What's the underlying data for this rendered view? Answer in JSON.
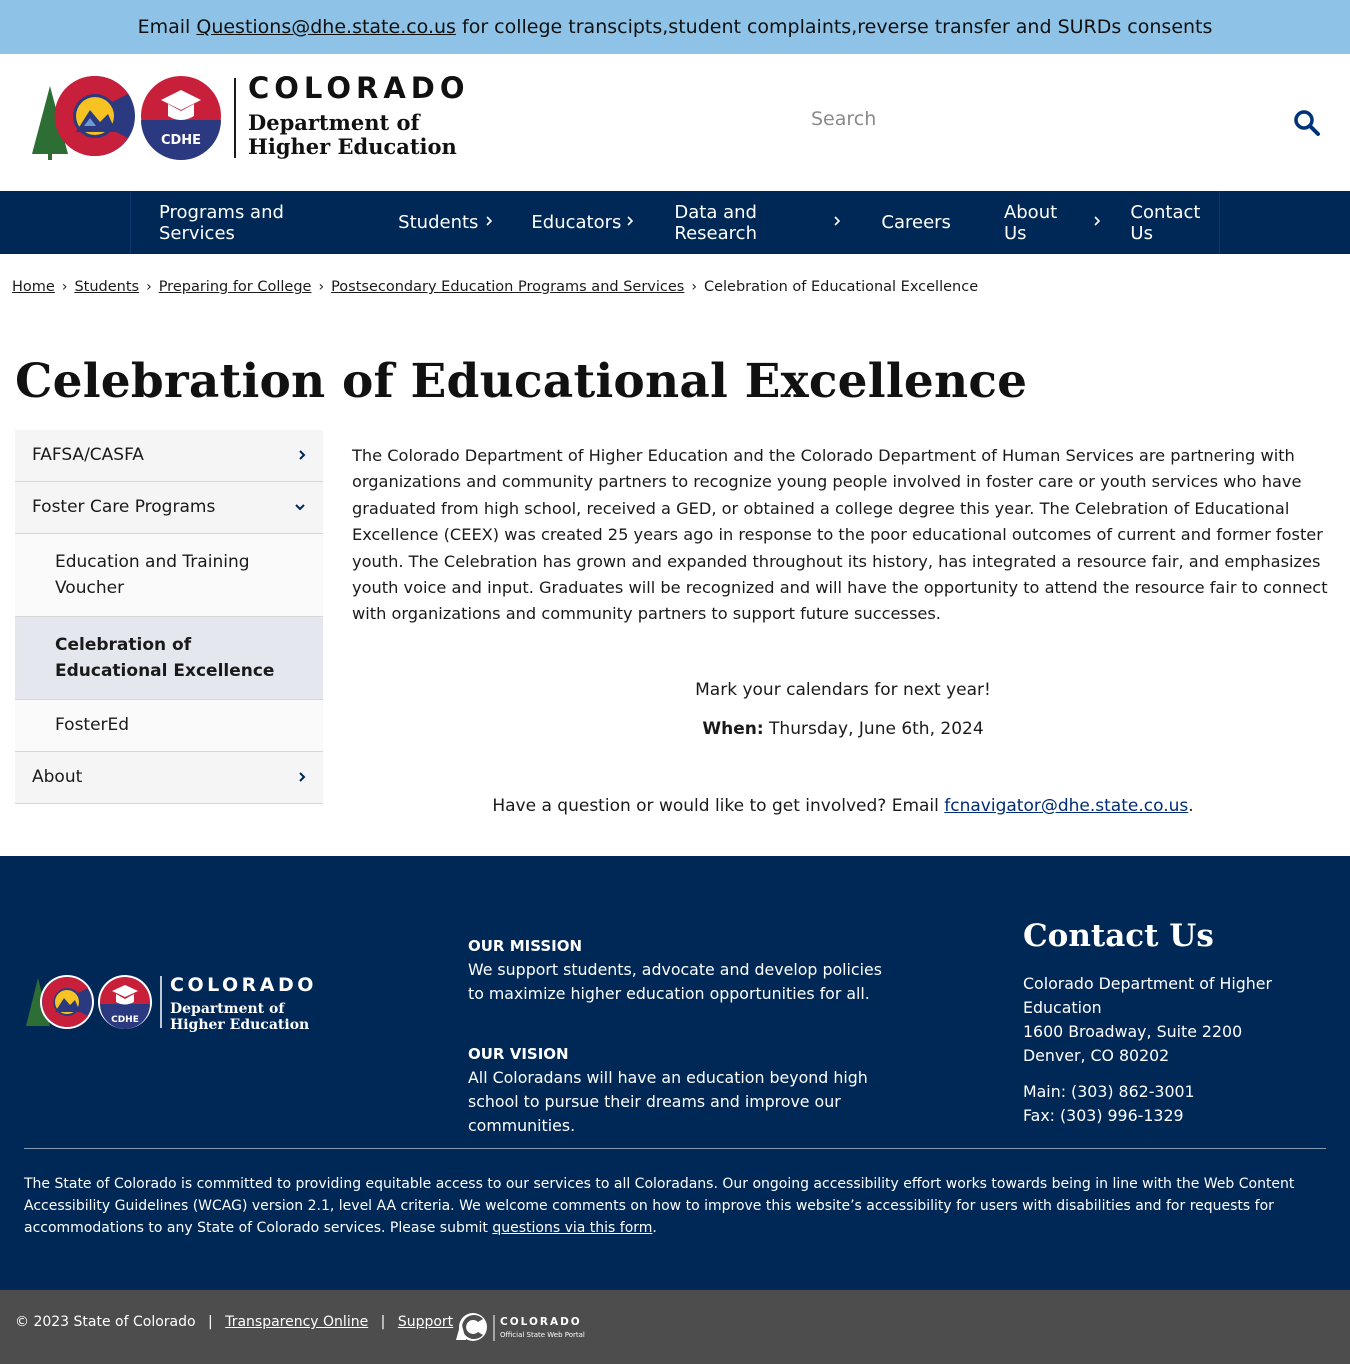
{
  "alert": {
    "prefix": "Email",
    "email": "Questions@dhe.state.co.us",
    "suffix": "for college transcipts,student complaints,reverse transfer and SURDs consents"
  },
  "header": {
    "logo_state": "COLORADO",
    "logo_dept_1": "Department of",
    "logo_dept_2": "Higher Education",
    "logo_badge": "CDHE",
    "search_placeholder": "Search"
  },
  "nav": {
    "items": [
      {
        "label": "Programs and Services",
        "has_submenu": false
      },
      {
        "label": "Students",
        "has_submenu": true
      },
      {
        "label": "Educators",
        "has_submenu": true
      },
      {
        "label": "Data and Research",
        "has_submenu": true
      },
      {
        "label": "Careers",
        "has_submenu": false
      },
      {
        "label": "About Us",
        "has_submenu": true
      },
      {
        "label": "Contact Us",
        "has_submenu": false
      }
    ]
  },
  "breadcrumb": {
    "items": [
      "Home",
      "Students",
      "Preparing for College",
      "Postsecondary Education Programs and Services"
    ],
    "current": "Celebration of Educational Excellence"
  },
  "page": {
    "title": "Celebration of Educational Excellence"
  },
  "sidebar": {
    "fafsa": "FAFSA/CASFA",
    "foster": "Foster Care Programs",
    "etv": "Education and Training Voucher",
    "ceex": "Celebration of Educational Excellence",
    "fostered": "FosterEd",
    "about": "About"
  },
  "content": {
    "intro": "The Colorado Department of Higher Education and the Colorado Department of Human Services are partnering with organizations and community partners to recognize young people involved in foster care or youth services who have graduated from high school, received a GED, or obtained a college degree this year. The Celebration of Educational Excellence (CEEX) was created 25 years ago in response to the poor educational outcomes of current and former foster youth. The Celebration has grown and expanded throughout its history, has integrated a resource fair, and emphasizes youth voice and input. Graduates will be recognized and will have the opportunity to attend the resource fair to connect with organizations and community partners to support future successes.",
    "mark": "Mark your calendars for next year!",
    "when_label": "When:",
    "when_value": "Thursday, June 6th, 2024",
    "question_prefix": "Have a question or would like to get involved? Email",
    "question_email": "fcnavigator@dhe.state.co.us",
    "question_suffix": "."
  },
  "footer": {
    "logo_state": "COLORADO",
    "logo_dept_1": "Department of",
    "logo_dept_2": "Higher Education",
    "logo_badge": "CDHE",
    "mission_heading": "OUR MISSION",
    "mission_text": "We support students, advocate and develop policies to maximize higher education opportunities for all.",
    "vision_heading": "OUR VISION",
    "vision_text": "All Coloradans will have an education beyond high school to pursue their dreams and improve our communities.",
    "contact_heading": "Contact Us",
    "contact_org": "Colorado Department of Higher Education",
    "contact_street": "1600 Broadway, Suite 2200",
    "contact_city": "Denver, CO 80202",
    "contact_main": "Main: (303) 862-3001",
    "contact_fax": "Fax: (303) 996-1329",
    "access_text": "The State of Colorado is committed to providing equitable access to our services to all Coloradans. Our ongoing accessibility effort works towards being in line with the Web Content Accessibility Guidelines (WCAG) version 2.1, level AA criteria. We welcome comments on how to improve this website’s accessibility for users with disabilities and for requests for accommodations to any State of Colorado services. Please submit",
    "access_link": "questions via this form",
    "access_end": "."
  },
  "bottom": {
    "copyright": "© 2023 State of Colorado",
    "transparency": "Transparency Online",
    "support": "Support",
    "state_logo_1": "COLORADO",
    "state_logo_2": "Official State Web Portal"
  },
  "colors": {
    "alert_bg": "#8ec2e6",
    "navy": "#002856",
    "footer_gray": "#4d4d4d",
    "accent_red": "#c8203a",
    "accent_blue": "#2b3a80",
    "link_blue": "#002c77"
  }
}
